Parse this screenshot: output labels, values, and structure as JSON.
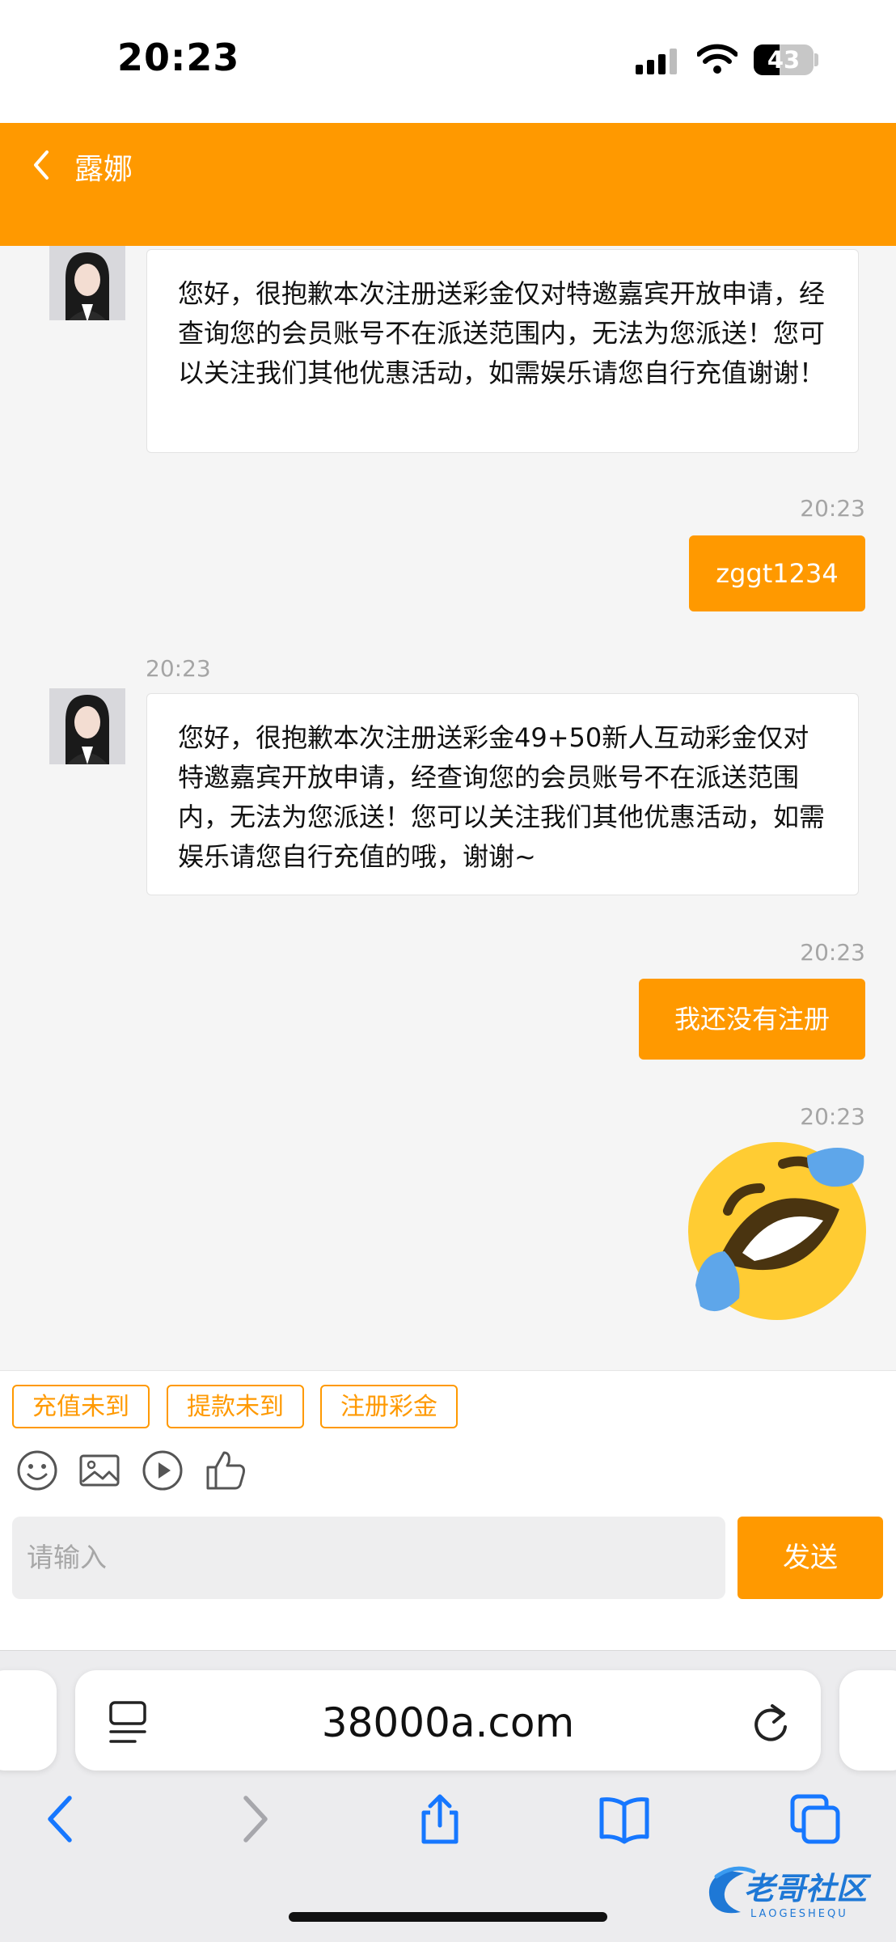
{
  "status_bar": {
    "time": "20:23",
    "battery": "43",
    "battery_level": 0.43
  },
  "header": {
    "title": "露娜"
  },
  "messages": [
    {
      "side": "in",
      "text": "您好，很抱歉本次注册送彩金仅对特邀嘉宾开放申请，经查询您的会员账号不在派送范围内，无法为您派送！您可以关注我们其他优惠活动，如需娱乐请您自行充值谢谢！"
    },
    {
      "side": "out",
      "time": "20:23",
      "text": "zggt1234"
    },
    {
      "side": "in",
      "time": "20:23",
      "text": "您好，很抱歉本次注册送彩金49+50新人互动彩金仅对特邀嘉宾开放申请，经查询您的会员账号不在派送范围内，无法为您派送！您可以关注我们其他优惠活动，如需娱乐请您自行充值的哦，谢谢~"
    },
    {
      "side": "out",
      "time": "20:23",
      "text": "我还没有注册"
    },
    {
      "side": "out",
      "time": "20:23",
      "sticker": "rolling-on-floor-laughing-emoji"
    }
  ],
  "quick_replies": [
    "充值未到",
    "提款未到",
    "注册彩金"
  ],
  "toolbar": {
    "icons": [
      "smiley-icon",
      "image-icon",
      "video-play-icon",
      "thumbs-up-icon"
    ]
  },
  "composer": {
    "placeholder": "请输入",
    "send_label": "发送"
  },
  "browser": {
    "url": "38000a.com"
  },
  "watermark": {
    "text": "老哥社区",
    "subtext": "LAOGESHEQU"
  },
  "colors": {
    "accent": "#ff9900",
    "background": "#f5f5f5"
  }
}
